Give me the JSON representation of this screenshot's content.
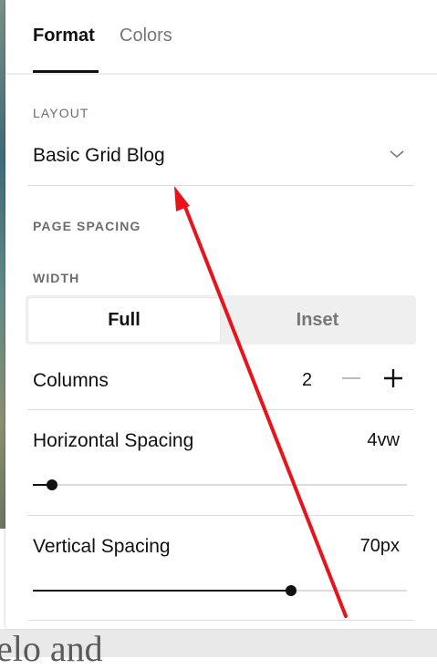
{
  "tabs": [
    {
      "label": "Format",
      "active": true
    },
    {
      "label": "Colors",
      "active": false
    }
  ],
  "layout": {
    "section_label": "LAYOUT",
    "selected": "Basic Grid Blog"
  },
  "page_spacing": {
    "section_label": "PAGE SPACING",
    "width_label": "WIDTH",
    "width_options": [
      "Full",
      "Inset"
    ],
    "width_selected": "Full"
  },
  "columns": {
    "label": "Columns",
    "value": "2"
  },
  "horizontal_spacing": {
    "label": "Horizontal Spacing",
    "value": "4vw",
    "slider_fraction": 0.05
  },
  "vertical_spacing": {
    "label": "Vertical Spacing",
    "value": "70px",
    "slider_fraction": 0.69
  },
  "background_text": "elo and",
  "icons": {
    "layout_dropdown": "chevron-down-icon",
    "columns_decrease": "minus-icon",
    "columns_increase": "plus-icon",
    "annotation": "red-arrow-annotation"
  },
  "colors": {
    "accent": "#111111",
    "annotation_arrow": "#e8131b",
    "muted_text": "#777777",
    "segment_bg": "#efefef"
  }
}
